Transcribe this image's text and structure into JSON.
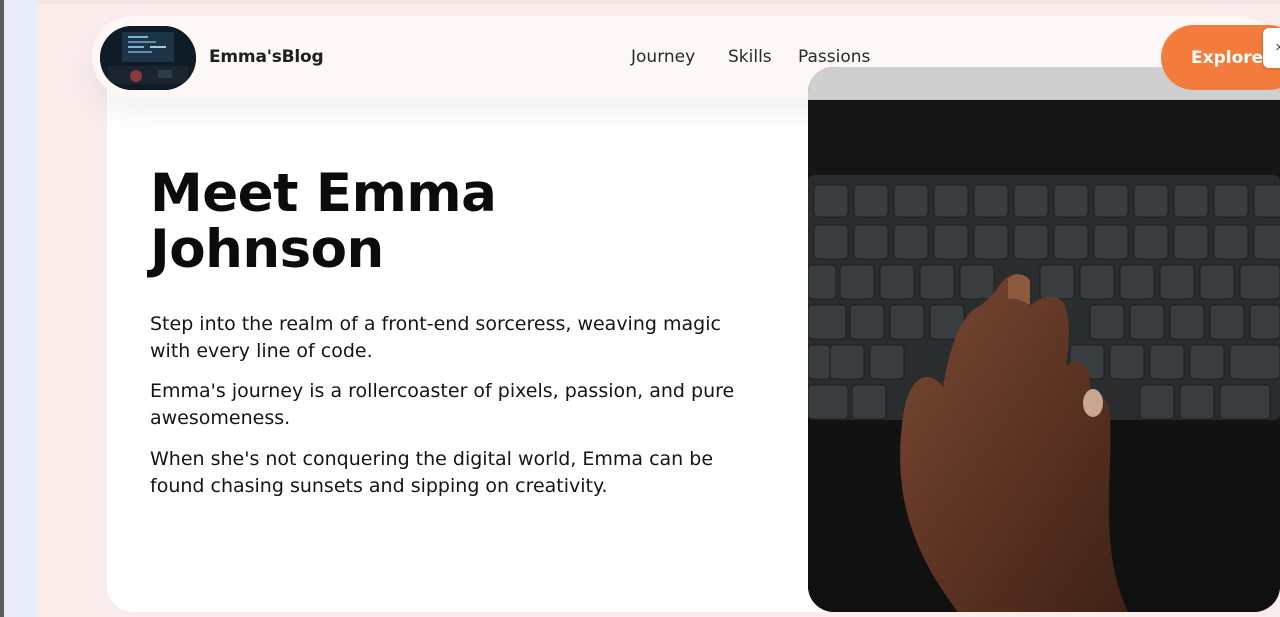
{
  "header": {
    "brand": "Emma'sBlog",
    "nav": [
      {
        "label": "Journey"
      },
      {
        "label": "Skills"
      },
      {
        "label": "Passions"
      }
    ],
    "cta_label": "Explore"
  },
  "hero": {
    "title": "Meet Emma Johnson",
    "paragraphs": [
      "Step into the realm of a front-end sorceress, weaving magic with every line of code.",
      "Emma's journey is a rollercoaster of pixels, passion, and pure awesomeness.",
      "When she's not conquering the digital world, Emma can be found chasing sunsets and sipping on creativity."
    ],
    "image_subject": "hand typing on a dark keyboard"
  },
  "colors": {
    "accent": "#f47c3c",
    "page_background": "#fbecec",
    "card": "#ffffff",
    "text": "#0b0b0b"
  }
}
